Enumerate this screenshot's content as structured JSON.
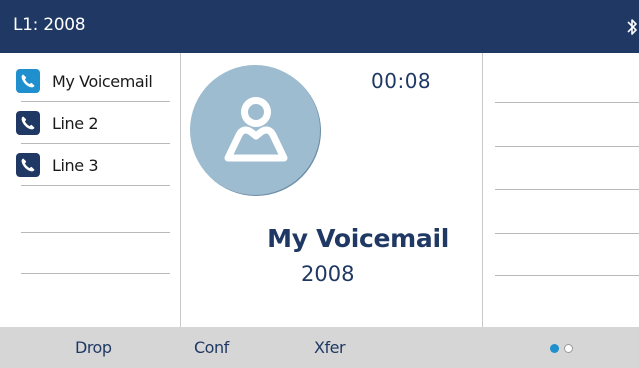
{
  "header": {
    "line_label": "L1: 2008",
    "status_icon": "bluetooth-icon"
  },
  "line_keys": [
    {
      "label": "My Voicemail",
      "icon": "phone-icon",
      "state": "active",
      "color": "#1f8fce"
    },
    {
      "label": "Line 2",
      "icon": "phone-icon",
      "state": "idle",
      "color": "#1f3864"
    },
    {
      "label": "Line 3",
      "icon": "phone-icon",
      "state": "idle",
      "color": "#1f3864"
    }
  ],
  "call": {
    "timer": "00:08",
    "name": "My Voicemail",
    "number": "2008",
    "avatar_icon": "contact-avatar-icon"
  },
  "softkeys": [
    "Drop",
    "Conf",
    "Xfer"
  ],
  "pagination": {
    "current_page": 1,
    "total_pages": 2
  },
  "colors": {
    "header_bg": "#1f3864",
    "accent": "#1f8fce",
    "softkey_bar_bg": "#d6d6d6"
  }
}
